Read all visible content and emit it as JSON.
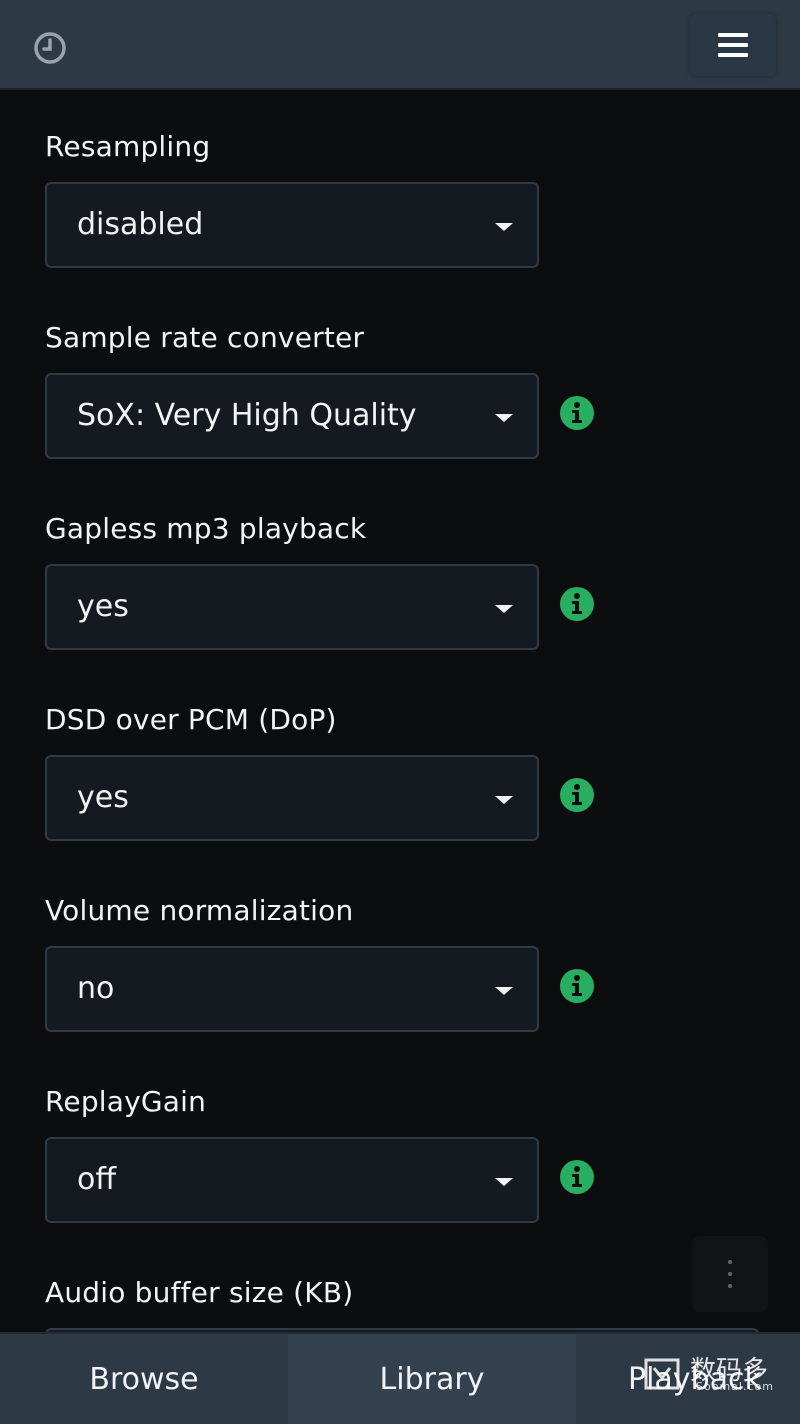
{
  "header": {
    "history_icon": "clock-icon",
    "menu_icon": "hamburger-icon"
  },
  "settings": [
    {
      "label": "Resampling",
      "value": "disabled",
      "info": false
    },
    {
      "label": "Sample rate converter",
      "value": "SoX: Very High Quality",
      "info": true
    },
    {
      "label": "Gapless mp3 playback",
      "value": "yes",
      "info": true
    },
    {
      "label": "DSD over PCM (DoP)",
      "value": "yes",
      "info": true
    },
    {
      "label": "Volume normalization",
      "value": "no",
      "info": true
    },
    {
      "label": "ReplayGain",
      "value": "off",
      "info": true
    },
    {
      "label": "Audio buffer size (KB)"
    }
  ],
  "fab": {
    "icon": "more-vertical-icon"
  },
  "tabs": [
    {
      "label": "Browse"
    },
    {
      "label": "Library"
    },
    {
      "label": "Playback"
    }
  ],
  "watermark": {
    "text": "数码多",
    "sub": "Soomal.com"
  },
  "colors": {
    "header_bg": "#2d3a46",
    "page_bg": "#0c0d0e",
    "select_bg": "#141a1f",
    "select_border": "#2f3b47",
    "info_green": "#27ae60"
  }
}
